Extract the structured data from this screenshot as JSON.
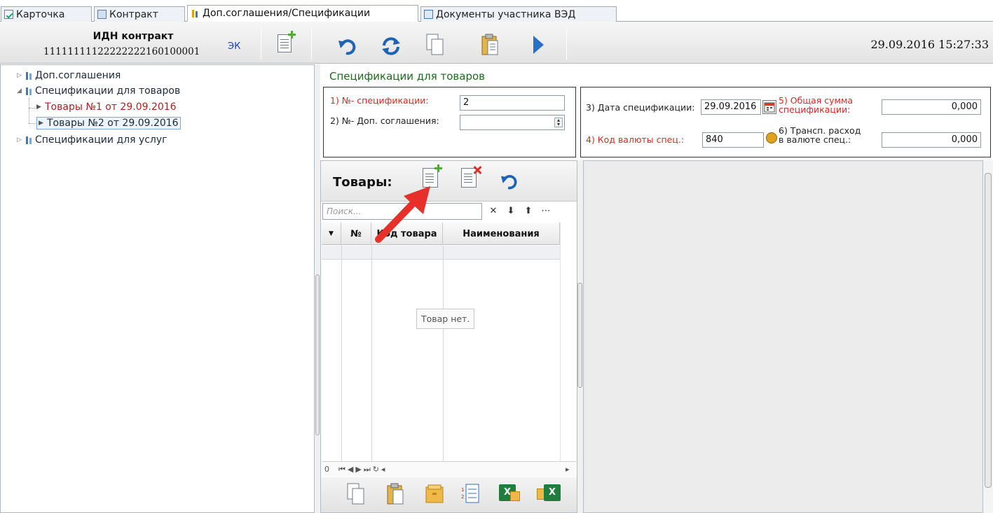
{
  "tabs": [
    {
      "label": "Карточка"
    },
    {
      "label": "Контракт"
    },
    {
      "label": "Доп.соглашения/Спецификации",
      "active": true
    },
    {
      "label": "Документы участника ВЭД"
    }
  ],
  "toolbar": {
    "idn_title": "ИДН контракт",
    "idn_number": "11111111122222222160100001",
    "ek": "ЭК",
    "datetime": "29.09.2016 15:27:33"
  },
  "tree": {
    "items": [
      {
        "label": "Доп.соглашения"
      },
      {
        "label": "Спецификации для товаров"
      },
      {
        "label": "Товары №1 от 29.09.2016"
      },
      {
        "label": "Товары №2 от 29.09.2016"
      },
      {
        "label": "Спецификации для услуг"
      }
    ]
  },
  "spec": {
    "title": "Спецификации для товаров",
    "field1_label": "1) №- спецификации:",
    "field1_value": "2",
    "field2_label": "2) №- Доп. соглашения:",
    "field2_value": "",
    "field3_label": "3) Дата спецификации:",
    "field3_value": "29.09.2016",
    "field4_label": "4) Код валюты спец.:",
    "field4_value": "840",
    "field5_label_1": "5) Общая сумма",
    "field5_label_2": "спецификации:",
    "field5_value": "0,000",
    "field6_label_1": "6) Трансп. расход",
    "field6_label_2": "в валюте спец.:",
    "field6_value": "0,000"
  },
  "goods": {
    "title": "Товары:",
    "search_placeholder": "Поиск...",
    "columns": [
      "№",
      "Код товара",
      "Наименования"
    ],
    "empty_message": "Товар нет.",
    "pager_count": "0"
  },
  "colors": {
    "required_label": "#e0261e",
    "section_title": "#1d6b1d",
    "arrow": "#e8302a"
  }
}
